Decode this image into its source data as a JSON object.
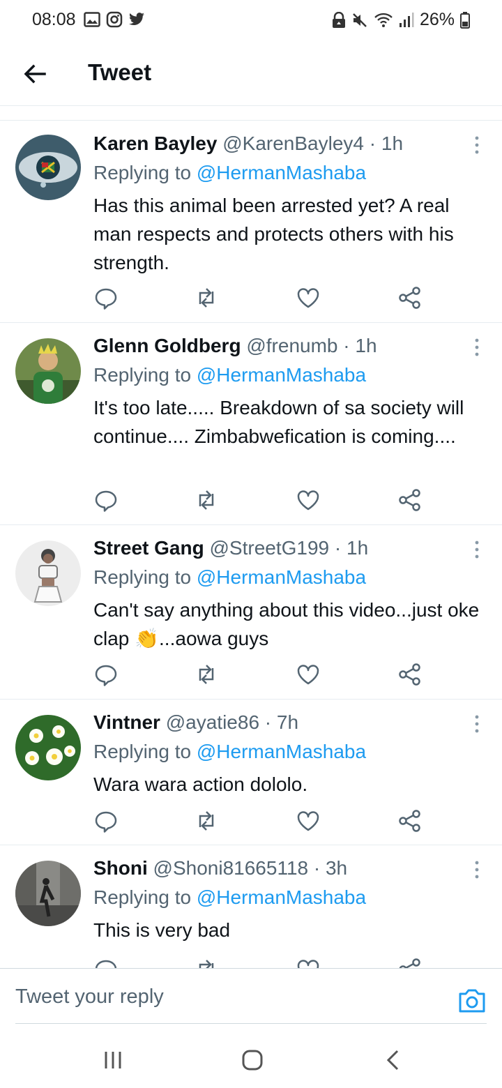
{
  "status_bar": {
    "time": "08:08",
    "battery": "26%"
  },
  "header": {
    "title": "Tweet"
  },
  "tweets": [
    {
      "name": "Karen Bayley",
      "handle": "@KarenBayley4",
      "time": "1h",
      "replying_prefix": "Replying to",
      "replying_to": "@HermanMashaba",
      "text": "Has this animal been arrested yet? A real man respects and protects others with his strength."
    },
    {
      "name": "Glenn Goldberg",
      "handle": "@frenumb",
      "time": "1h",
      "replying_prefix": "Replying to",
      "replying_to": "@HermanMashaba",
      "text": "It's too late..... Breakdown of sa society will continue.... Zimbabwefication is coming...."
    },
    {
      "name": "Street Gang",
      "handle": "@StreetG199",
      "time": "1h",
      "replying_prefix": "Replying to",
      "replying_to": "@HermanMashaba",
      "text_before": "Can't say anything about this video...just oke clap ",
      "emoji": "👏",
      "text_after": "...aowa guys"
    },
    {
      "name": "Vintner",
      "handle": "@ayatie86",
      "time": "7h",
      "replying_prefix": "Replying to",
      "replying_to": "@HermanMashaba",
      "text": "Wara wara action dololo."
    },
    {
      "name": "Shoni",
      "handle": "@Shoni81665118",
      "time": "3h",
      "replying_prefix": "Replying to",
      "replying_to": "@HermanMashaba",
      "text": "This is very bad"
    }
  ],
  "reply_bar": {
    "placeholder": "Tweet your reply"
  },
  "colors": {
    "accent": "#1d9bf0",
    "secondary_text": "#536471",
    "divider": "#e6ecf0"
  }
}
